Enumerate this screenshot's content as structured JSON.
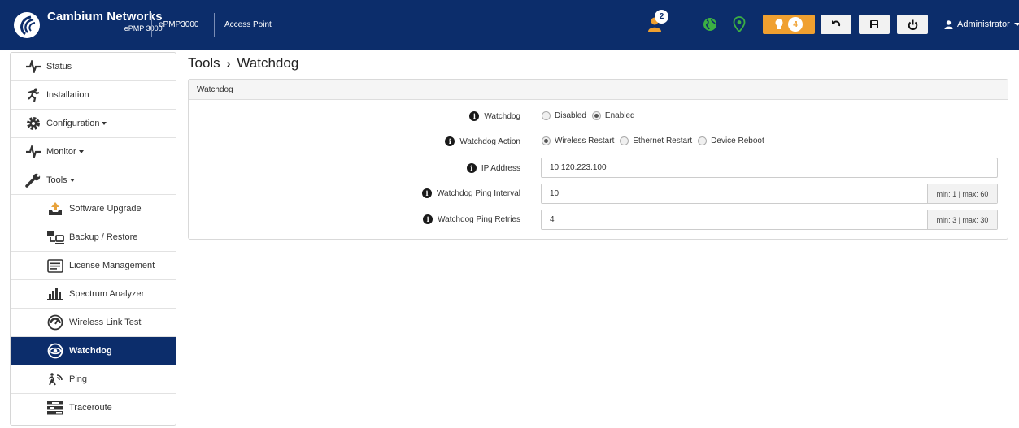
{
  "header": {
    "brand": "Cambium Networks",
    "model": "ePMP 3000",
    "device": "ePMP3000",
    "mode": "Access Point",
    "user_alert_count": "2",
    "alerts_count": "4",
    "user": "Administrator",
    "colors": {
      "bar": "#0c2d6b",
      "alert": "#f0a030",
      "green": "#3cb043"
    }
  },
  "sidebar": {
    "items": [
      {
        "label": "Status",
        "icon": "pulse-icon"
      },
      {
        "label": "Installation",
        "icon": "running-person-icon"
      },
      {
        "label": "Configuration",
        "icon": "gear-icon"
      },
      {
        "label": "Monitor",
        "icon": "pulse-icon"
      },
      {
        "label": "Tools",
        "icon": "wrench-icon"
      }
    ],
    "tools": [
      {
        "label": "Software Upgrade",
        "icon": "upload-icon"
      },
      {
        "label": "Backup / Restore",
        "icon": "backup-icon"
      },
      {
        "label": "License Management",
        "icon": "license-icon"
      },
      {
        "label": "Spectrum Analyzer",
        "icon": "bar-chart-icon"
      },
      {
        "label": "Wireless Link Test",
        "icon": "gauge-icon"
      },
      {
        "label": "Watchdog",
        "icon": "eye-icon",
        "active": true
      },
      {
        "label": "Ping",
        "icon": "ping-icon"
      },
      {
        "label": "Traceroute",
        "icon": "traceroute-icon"
      }
    ]
  },
  "main": {
    "breadcrumb_parent": "Tools",
    "title": "Watchdog",
    "panel_title": "Watchdog",
    "watchdog": {
      "label": "Watchdog",
      "options": [
        "Disabled",
        "Enabled"
      ],
      "selected": "Enabled"
    },
    "action": {
      "label": "Watchdog Action",
      "options": [
        "Wireless Restart",
        "Ethernet Restart",
        "Device Reboot"
      ],
      "selected": "Wireless Restart"
    },
    "ip": {
      "label": "IP Address",
      "value": "10.120.223.100"
    },
    "interval": {
      "label": "Watchdog Ping Interval",
      "value": "10",
      "hint": "min: 1 | max: 60"
    },
    "retries": {
      "label": "Watchdog Ping Retries",
      "value": "4",
      "hint": "min: 3 | max: 30"
    }
  }
}
